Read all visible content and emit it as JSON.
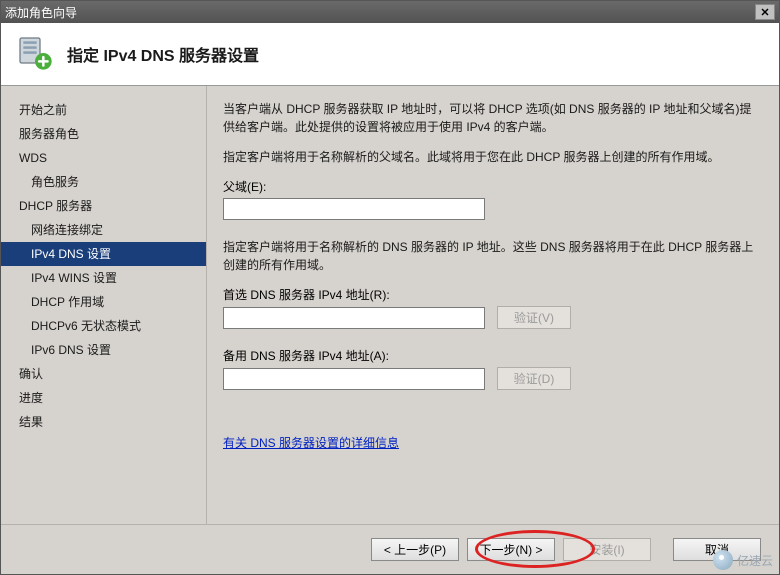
{
  "window": {
    "title": "添加角色向导",
    "close_glyph": "✕"
  },
  "header": {
    "title": "指定 IPv4 DNS 服务器设置"
  },
  "sidebar": {
    "items": [
      {
        "label": "开始之前",
        "sub": false,
        "selected": false
      },
      {
        "label": "服务器角色",
        "sub": false,
        "selected": false
      },
      {
        "label": "WDS",
        "sub": false,
        "selected": false
      },
      {
        "label": "角色服务",
        "sub": true,
        "selected": false
      },
      {
        "label": "DHCP 服务器",
        "sub": false,
        "selected": false
      },
      {
        "label": "网络连接绑定",
        "sub": true,
        "selected": false
      },
      {
        "label": "IPv4 DNS 设置",
        "sub": true,
        "selected": true
      },
      {
        "label": "IPv4 WINS 设置",
        "sub": true,
        "selected": false
      },
      {
        "label": "DHCP 作用域",
        "sub": true,
        "selected": false
      },
      {
        "label": "DHCPv6 无状态模式",
        "sub": true,
        "selected": false
      },
      {
        "label": "IPv6 DNS 设置",
        "sub": true,
        "selected": false
      },
      {
        "label": "确认",
        "sub": false,
        "selected": false
      },
      {
        "label": "进度",
        "sub": false,
        "selected": false
      },
      {
        "label": "结果",
        "sub": false,
        "selected": false
      }
    ]
  },
  "content": {
    "para1": "当客户端从 DHCP 服务器获取 IP 地址时，可以将 DHCP 选项(如 DNS 服务器的 IP 地址和父域名)提供给客户端。此处提供的设置将被应用于使用 IPv4 的客户端。",
    "para2": "指定客户端将用于名称解析的父域名。此域将用于您在此 DHCP 服务器上创建的所有作用域。",
    "parent_domain_label": "父域(E):",
    "parent_domain_value": "",
    "para3": "指定客户端将用于名称解析的 DNS 服务器的 IP 地址。这些 DNS 服务器将用于在此 DHCP 服务器上创建的所有作用域。",
    "pref_dns_label": "首选 DNS 服务器 IPv4 地址(R):",
    "pref_dns_value": "",
    "alt_dns_label": "备用 DNS 服务器 IPv4 地址(A):",
    "alt_dns_value": "",
    "validate_btn1": "验证(V)",
    "validate_btn2": "验证(D)",
    "link_text": "有关 DNS 服务器设置的详细信息"
  },
  "footer": {
    "prev": "< 上一步(P)",
    "next": "下一步(N) >",
    "install": "安装(I)",
    "cancel": "取消"
  },
  "watermark": "亿速云"
}
